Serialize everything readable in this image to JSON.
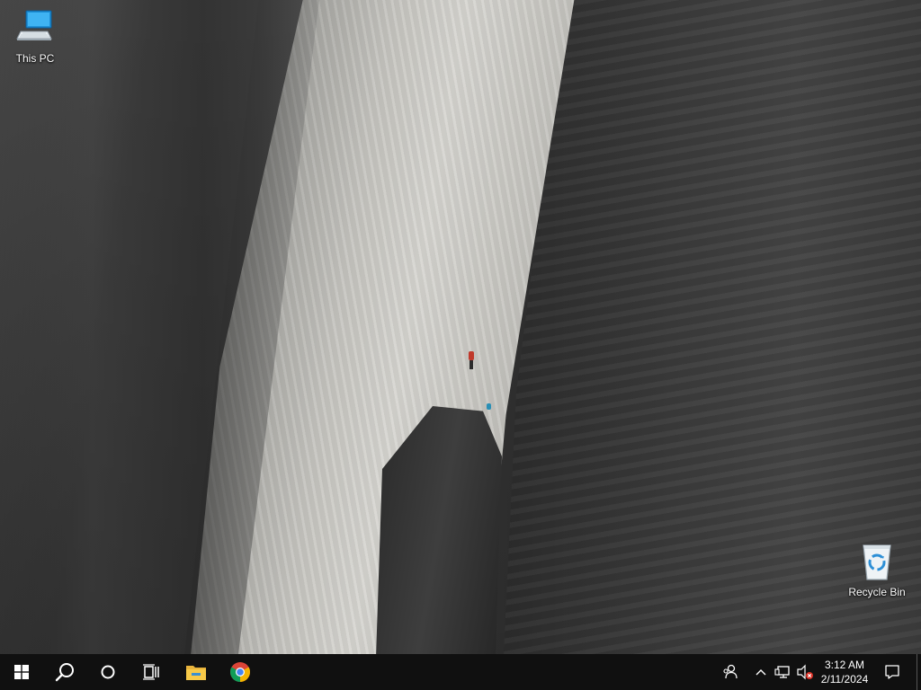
{
  "desktop": {
    "icons": [
      {
        "label": "This PC",
        "icon": "this-pc-icon"
      },
      {
        "label": "Recycle Bin",
        "icon": "recycle-bin-icon"
      }
    ]
  },
  "taskbar": {
    "start": {
      "icon": "windows-start-icon"
    },
    "search": {
      "icon": "search-icon"
    },
    "cortana": {
      "icon": "cortana-circle-icon"
    },
    "task_view": {
      "icon": "task-view-icon"
    },
    "pinned": [
      {
        "icon": "file-explorer-icon"
      },
      {
        "icon": "chrome-icon"
      }
    ],
    "tray": {
      "people_icon": "people-icon",
      "chevron_icon": "chevron-up-icon",
      "network_icon": "network-icon",
      "volume_icon": "volume-muted-icon",
      "clock": {
        "time": "3:12 AM",
        "date": "2/11/2024"
      },
      "notification_icon": "notification-icon"
    }
  }
}
